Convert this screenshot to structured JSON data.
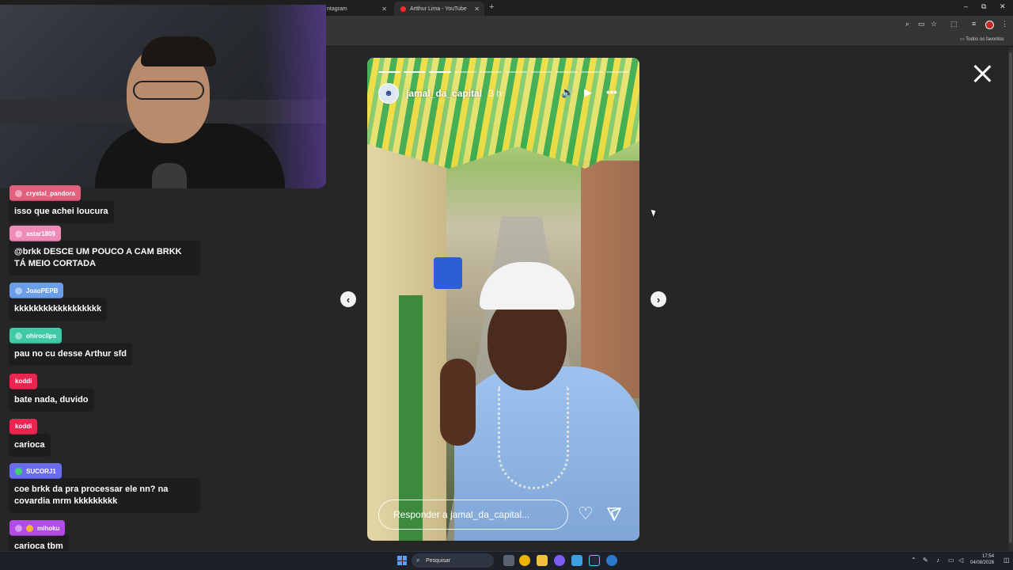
{
  "browser": {
    "tabs": [
      {
        "label": "ntagram"
      },
      {
        "label": "Artthur Lima - YouTube"
      }
    ],
    "new_tab_label": "+",
    "window_controls": {
      "minimize": "–",
      "restore": "⧉",
      "close": "✕"
    },
    "bookmarks_label": "Todos os favoritos"
  },
  "chat": {
    "messages": [
      {
        "user": "crystal_pandora",
        "text": "isso que achei loucura",
        "badge_color": "#e0607e"
      },
      {
        "user": "astar1809",
        "text": "@brkk DESCE UM POUCO A CAM BRKK TÁ MEIO CORTADA",
        "badge_color": "#f08bb8"
      },
      {
        "user": "JoaoPEPB",
        "text": "kkkkkkkkkkkkkkkkkk",
        "badge_color": "#6b9ee8"
      },
      {
        "user": "ohiroclips",
        "text": "pau no cu desse Arthur sfd",
        "badge_color": "#3fc9a6"
      },
      {
        "user": "koddi",
        "text": "bate nada, duvido",
        "badge_color": "#e8264f"
      },
      {
        "user": "koddi",
        "text": "carioca",
        "badge_color": "#e8264f"
      },
      {
        "user": "SUCORJ1",
        "text": "coe brkk da pra processar ele nn? na covardia mrm kkkkkkkkk",
        "badge_color": "#6a6cf0"
      },
      {
        "user": "mihoku",
        "text": "carioca tbm",
        "badge_color": "#b24ce6"
      }
    ]
  },
  "story": {
    "username": "jamal_da_capital",
    "time": "3 h",
    "reply_placeholder": "Responder a jamal_da_capital...",
    "segments_total": 10,
    "segments_done": 3,
    "icons": {
      "sound": "🔊",
      "play": "▶",
      "more": "•••"
    }
  },
  "viewer": {
    "prev": "‹",
    "next": "›"
  },
  "taskbar": {
    "search_label": "Pesquisar",
    "time": "17:54",
    "date": "04/08/2026"
  }
}
